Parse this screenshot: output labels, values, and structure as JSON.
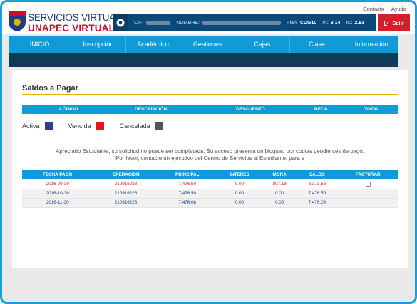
{
  "header": {
    "brand_line1": "SERVICIOS VIRTUALES",
    "brand_line2": "UNAPEC VIRTUAL",
    "links": {
      "contacto": "Contacto",
      "sep": "|",
      "ayuda": "Ayuda"
    },
    "info": {
      "cif_label": "CIF:",
      "nombre_label": "NOMBRE:",
      "plan_label": "Plan:",
      "plan_value": "CDG10",
      "ia_label": "IA:",
      "ia_value": "3.14",
      "ic_label": "IC:",
      "ic_value": "2.81"
    },
    "salir": "Salir"
  },
  "nav": [
    "INICIO",
    "Inscripción",
    "Académico",
    "Gestiones",
    "Cajas",
    "Clase",
    "Información"
  ],
  "page": {
    "title": "Saldos a Pagar",
    "summary_headers": [
      "CÓDIGO",
      "DESCRIPCIÓN",
      "DESCUENTO",
      "BECA",
      "TOTAL"
    ],
    "legend": [
      {
        "label": "Activa",
        "color": "#2b3f8f"
      },
      {
        "label": "Vencida",
        "color": "#e8151b"
      },
      {
        "label": "Cancelada",
        "color": "#555555"
      }
    ],
    "message_line1": "Apreciado Estudiante, su solicitud no puede ser completada. Su acceso presenta un bloqueo por cuotas pendientes de pago.",
    "message_line2": "Por favor, contacte un ejecutivo del Centro de Servicios al Estudiante, para s",
    "table_headers": [
      "FECHA PAGO",
      "OPERACION",
      "PRINCIPAL",
      "INTERES",
      "MORA",
      "SALDO",
      "FACTURAR"
    ],
    "rows": [
      {
        "fecha": "2016-09-30",
        "operacion": "210916228",
        "principal": "7,476.50",
        "interes": "0.00",
        "mora": "897.18",
        "saldo": "8,373.68",
        "status": "vencida"
      },
      {
        "fecha": "2016-10-30",
        "operacion": "210916228",
        "principal": "7,476.50",
        "interes": "0.00",
        "mora": "0.00",
        "saldo": "7,476.50",
        "status": "activa"
      },
      {
        "fecha": "2016-11-30",
        "operacion": "210916228",
        "principal": "7,476.08",
        "interes": "0.00",
        "mora": "0.00",
        "saldo": "7,476.08",
        "status": "activa"
      }
    ]
  },
  "colors": {
    "accent": "#119ad6",
    "brand_red": "#c8102e",
    "navy": "#0f3a58",
    "title_underline": "#e3b200"
  }
}
